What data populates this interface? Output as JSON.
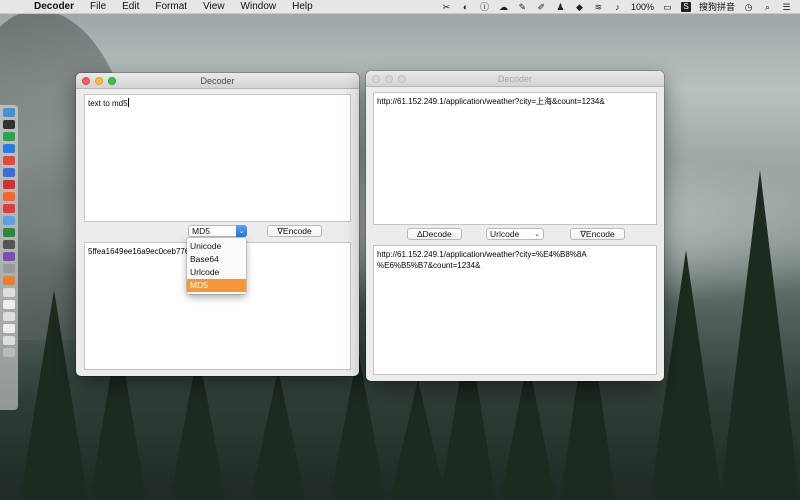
{
  "menubar": {
    "app_name": "Decoder",
    "items": [
      "File",
      "Edit",
      "Format",
      "View",
      "Window",
      "Help"
    ],
    "battery": "100%",
    "ime_label": "搜狗拼音"
  },
  "left_window": {
    "title": "Decoder",
    "input_text": "text to md5",
    "output_text": "5ffea1649ee16a9ec0ceb7768",
    "algo_selected": "MD5",
    "encode_label": "∇Encode",
    "dropdown_options": [
      "Unicode",
      "Base64",
      "Urlcode",
      "MD5"
    ],
    "dropdown_selected_index": 3
  },
  "right_window": {
    "title": "Decoder",
    "input_text": "http://61.152.249.1/application/weather?city=上海&count=1234&",
    "output_text": "http://61.152.249.1/application/weather?city=%E4%B8%8A\n%E6%B5%B7&count=1234&",
    "decode_label": "∆Decode",
    "algo_selected": "Urlcode",
    "encode_label": "∇Encode"
  },
  "colors": {
    "selection": "#f5963a",
    "select_arrow": "#2473e6"
  }
}
